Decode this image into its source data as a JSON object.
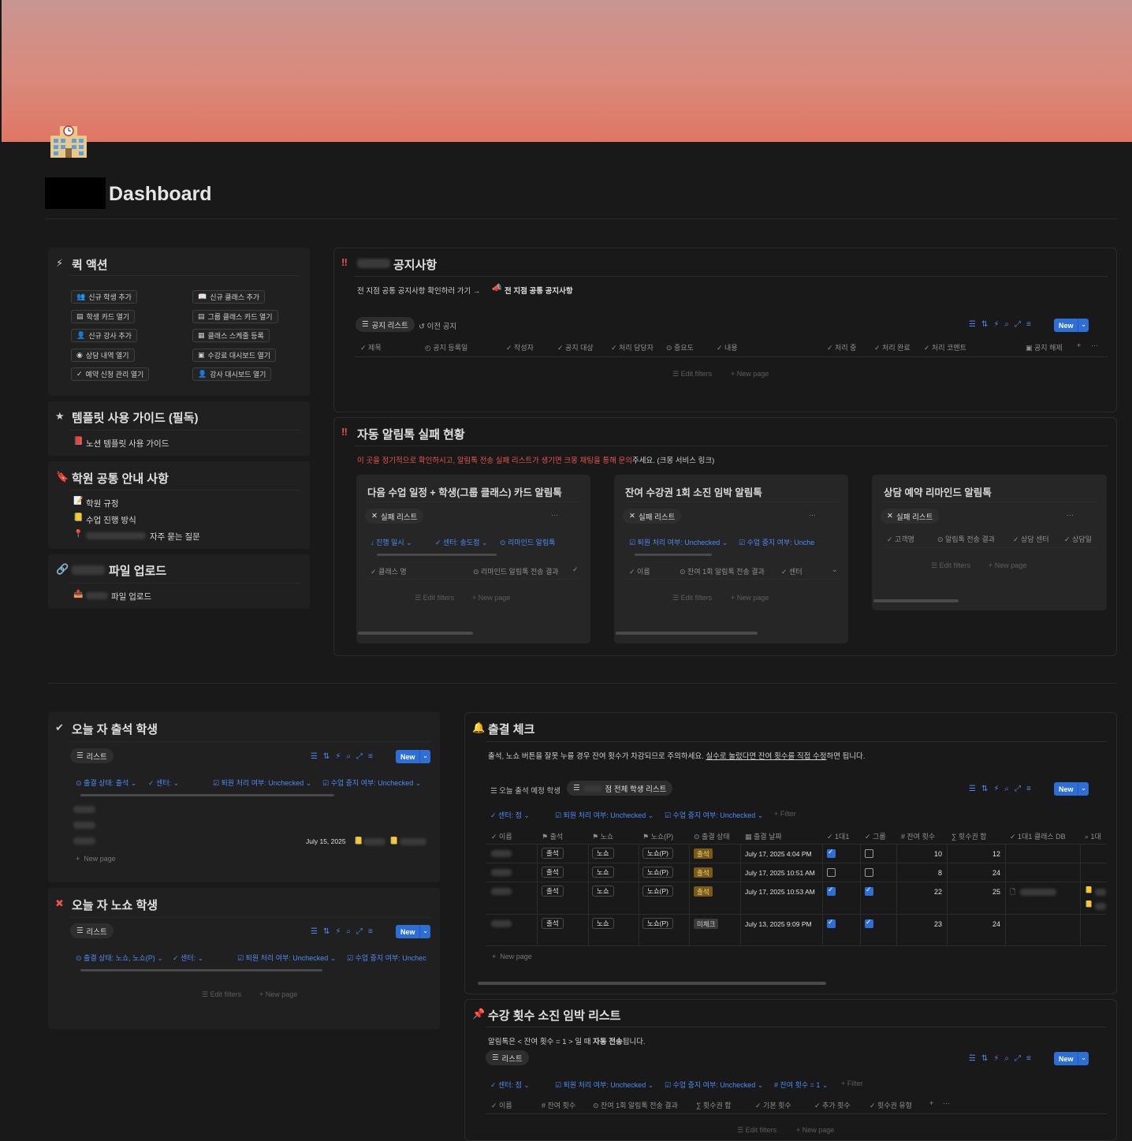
{
  "page": {
    "title": "Dashboard"
  },
  "quick": {
    "title": "퀵 액션",
    "buttons": [
      "신규 학생 추가",
      "신규 클래스 추가",
      "학생 카드 열기",
      "그룹 클래스 카드 열기",
      "신규 강사 추가",
      "클래스 스케줄 등록",
      "상담 내역 열기",
      "수강료 대시보드 열기",
      "예약 신청 관리 열기",
      "강사 대시보드 열기"
    ]
  },
  "guide": {
    "title": "템플릿 사용 가이드 (필독)",
    "item": "노션 템플릿 사용 가이드"
  },
  "common": {
    "title": "학원 공통 안내 사항",
    "items": [
      "학원 규정",
      "수업 진행 방식",
      "자주 묻는 질문"
    ]
  },
  "upload": {
    "title": "파일 업로드",
    "item": "파일 업로드"
  },
  "notice": {
    "title": "공지사항",
    "link_text": "전 지점 공통 공지사항 확인하러 가기 →",
    "link_target": "전 지점 공통 공지사항",
    "tabs": [
      "공지 리스트",
      "이전 공지"
    ],
    "columns": [
      "제목",
      "공지 등록일",
      "작성자",
      "공지 대상",
      "처리 담당자",
      "중요도",
      "내용",
      "처리 중",
      "처리 완료",
      "처리 코멘트",
      "공지 해제"
    ],
    "edit_filters": "Edit filters",
    "new_page": "New page",
    "new": "New"
  },
  "alert": {
    "title": "자동 알림톡 실패 현황",
    "desc_red": "이 곳을 정기적으로 확인하시고, 알림톡 전송 실패 리스트가 생기면 크몽 채팅을 통해 문의",
    "desc_rest": "주세요. (크몽 서비스 링크)",
    "cards": [
      {
        "title": "다음 수업 일정 + 학생(그룹 클래스) 카드 알림톡",
        "tab": "실패 리스트",
        "filters": [
          "↓ 진행 일시 ⌄",
          "센터: 송도점 ⌄",
          "리마인드 알림톡"
        ],
        "columns": [
          "클래스 명",
          "리마인드 알림톡 전송 결과"
        ],
        "edit_filters": "Edit filters",
        "new_page": "New page"
      },
      {
        "title": "잔여 수강권 1회 소진 임박 알림톡",
        "tab": "실패 리스트",
        "filters": [
          "퇴원 처리 여부: Unchecked ⌄",
          "수업 중지 여부: Unche"
        ],
        "columns": [
          "이름",
          "잔여 1회 알림톡 전송 결과",
          "센터"
        ],
        "edit_filters": "Edit filters",
        "new_page": "New page"
      },
      {
        "title": "상담 예약 리마인드 알림톡",
        "tab": "실패 리스트",
        "columns": [
          "고객명",
          "알림톡 전송 결과",
          "상담 센터",
          "상담일"
        ],
        "edit_filters": "Edit filters",
        "new_page": "New page"
      }
    ]
  },
  "attend": {
    "title": "오늘 자 출석 학생",
    "tab": "리스트",
    "filters": [
      "출결 상태: 출석 ⌄",
      "센터: ⌄",
      "퇴원 처리 여부: Unchecked ⌄",
      "수업 중지 여부: Unchecked ⌄"
    ],
    "date": "July 15, 2025",
    "new_page": "New page",
    "new": "New"
  },
  "noshow": {
    "title": "오늘 자 노쇼 학생",
    "tab": "리스트",
    "filters": [
      "출결 상태: 노쇼, 노쇼(P) ⌄",
      "센터: ⌄",
      "퇴원 처리 여부: Unchecked ⌄",
      "수업 중지 여부: Unchec"
    ],
    "edit_filters": "Edit filters",
    "new_page": "New page",
    "new": "New"
  },
  "check": {
    "title": "출결 체크",
    "desc_a": "출석, 노쇼 버튼을 잘못 누를 경우 잔여 횟수가 차감되므로 주의하세요. ",
    "desc_u": "실수로 눌렀다면 잔여 횟수를 직접 수정",
    "desc_b": "하면 됩니다.",
    "tabs": [
      "오늘 출석 예정 학생",
      "점 전체 학생 리스트"
    ],
    "filters": [
      "센터: 점 ⌄",
      "퇴원 처리 여부: Unchecked ⌄",
      "수업 중지 여부: Unchecked ⌄",
      "+ Filter"
    ],
    "columns": [
      "이름",
      "출석",
      "노쇼",
      "노쇼(P)",
      "출결 상태",
      "출결 날짜",
      "1대1",
      "그룹",
      "잔여 횟수",
      "횟수권 합",
      "1대1 클래스 DB",
      "1대"
    ],
    "rows": [
      {
        "btn1": "출석",
        "btn2": "노쇼",
        "btn3": "노쇼(P)",
        "status": "출석",
        "date": "July 17, 2025 4:04 PM",
        "one": true,
        "group": false,
        "remain": "10",
        "total": "12"
      },
      {
        "btn1": "출석",
        "btn2": "노쇼",
        "btn3": "노쇼(P)",
        "status": "출석",
        "date": "July 17, 2025 10:51 AM",
        "one": false,
        "group": false,
        "remain": "8",
        "total": "24"
      },
      {
        "btn1": "출석",
        "btn2": "노쇼",
        "btn3": "노쇼(P)",
        "status": "출석",
        "date": "July 17, 2025 10:53 AM",
        "one": true,
        "group": true,
        "remain": "22",
        "total": "25"
      },
      {
        "btn1": "출석",
        "btn2": "노쇼",
        "btn3": "노쇼(P)",
        "status": "미체크",
        "date": "July 13, 2025 9:09 PM",
        "one": true,
        "group": true,
        "remain": "23",
        "total": "24"
      }
    ],
    "new_page": "New page",
    "new": "New"
  },
  "soon": {
    "title": "수강 횟수 소진 임박 리스트",
    "desc_a": "알림톡은 < 잔여 횟수 = 1 > 일 때 ",
    "desc_b": "자동 전송",
    "desc_c": "됩니다.",
    "tab": "리스트",
    "filters": [
      "센터: 점 ⌄",
      "퇴원 처리 여부: Unchecked ⌄",
      "수업 중지 여부: Unchecked ⌄",
      "잔여 횟수 = 1 ⌄",
      "+ Filter"
    ],
    "columns": [
      "이름",
      "잔여 횟수",
      "잔여 1회 알림톡 전송 결과",
      "횟수권 합",
      "기본 횟수",
      "추가 횟수",
      "횟수권 유형"
    ],
    "edit_filters": "Edit filters",
    "new_page": "New page",
    "new": "New"
  }
}
